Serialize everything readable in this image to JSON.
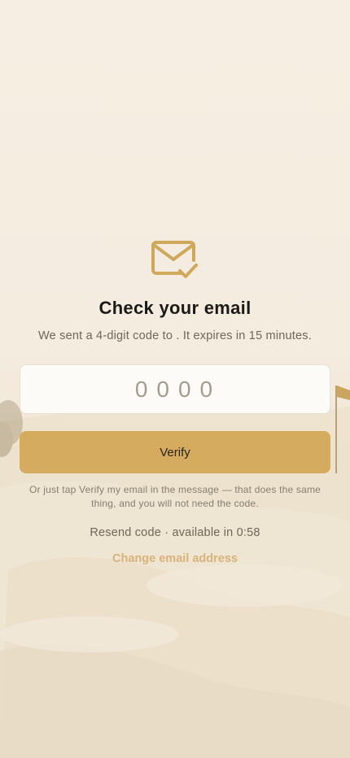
{
  "header": {
    "title": "Check your email",
    "subtitle": "We sent a 4-digit code to . It expires in 15 minutes."
  },
  "code_input": {
    "placeholder": "0000",
    "value": ""
  },
  "actions": {
    "verify_label": "Verify",
    "hint": "Or just tap Verify my email in the message — that does the same thing, and you will not need the code.",
    "resend_text": "Resend code · available in 0:58",
    "change_email_label": "Change email address"
  },
  "colors": {
    "accent": "#d4ab5f",
    "link": "#d8b37a",
    "background": "#f5ede0"
  },
  "icons": {
    "mail": "mail-check-icon"
  }
}
